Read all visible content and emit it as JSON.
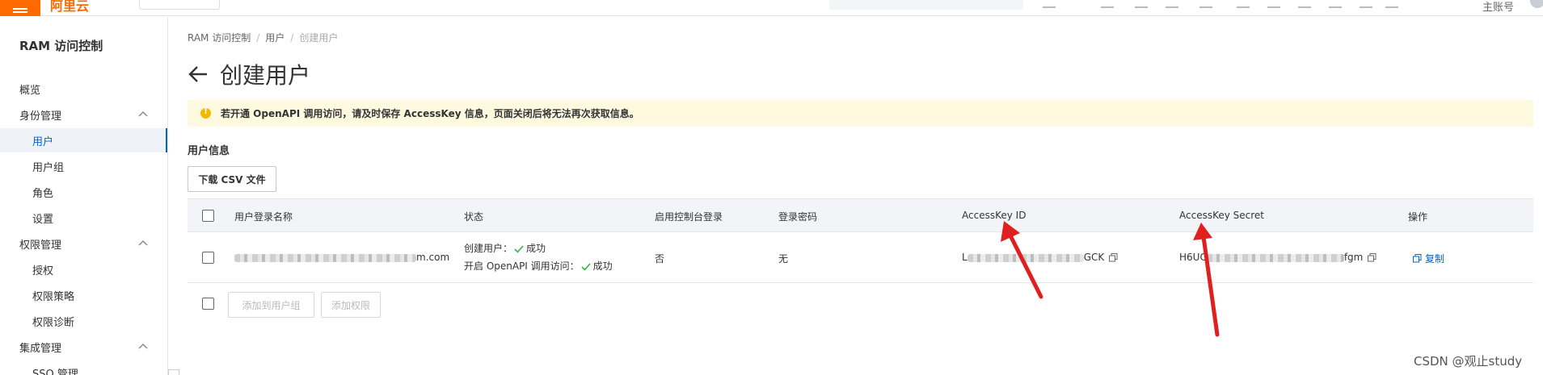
{
  "topbar": {
    "logo_text": "阿里云",
    "account_label": "主账号"
  },
  "sidebar": {
    "title": "RAM 访问控制",
    "items": [
      {
        "label": "概览",
        "kind": "group"
      },
      {
        "label": "身份管理",
        "kind": "group",
        "expanded": true
      },
      {
        "label": "用户",
        "kind": "child",
        "active": true
      },
      {
        "label": "用户组",
        "kind": "child"
      },
      {
        "label": "角色",
        "kind": "child"
      },
      {
        "label": "设置",
        "kind": "child"
      },
      {
        "label": "权限管理",
        "kind": "group",
        "expanded": true
      },
      {
        "label": "授权",
        "kind": "child"
      },
      {
        "label": "权限策略",
        "kind": "child"
      },
      {
        "label": "权限诊断",
        "kind": "child"
      },
      {
        "label": "集成管理",
        "kind": "group",
        "expanded": true
      },
      {
        "label": "SSO 管理",
        "kind": "child"
      }
    ]
  },
  "breadcrumb": [
    "RAM 访问控制",
    "用户",
    "创建用户"
  ],
  "page_title": "创建用户",
  "notice": "若开通 OpenAPI 调用访问，请及时保存 AccessKey 信息，页面关闭后将无法再次获取信息。",
  "section_title": "用户信息",
  "download_csv_label": "下载 CSV 文件",
  "table": {
    "headers": [
      "用户登录名称",
      "状态",
      "启用控制台登录",
      "登录密码",
      "AccessKey ID",
      "AccessKey Secret",
      "操作"
    ],
    "row": {
      "login_name_suffix": "m.com",
      "status_line1_label": "创建用户：",
      "status_line1_value": "成功",
      "status_line2_label": "开启 OpenAPI 调用访问：",
      "status_line2_value": "成功",
      "console_login": "否",
      "password": "无",
      "access_key_id_prefix": "L",
      "access_key_id_suffix": "GCK",
      "access_key_secret_prefix": "H6UC",
      "access_key_secret_suffix": "fgm",
      "action_label": "复制"
    },
    "footer_buttons": [
      "添加到用户组",
      "添加权限"
    ]
  },
  "watermark": "CSDN @观止study",
  "colors": {
    "brand": "#ff6a00",
    "link": "#0064c8",
    "success": "#2db83d",
    "annotation_arrow": "#e02020"
  }
}
